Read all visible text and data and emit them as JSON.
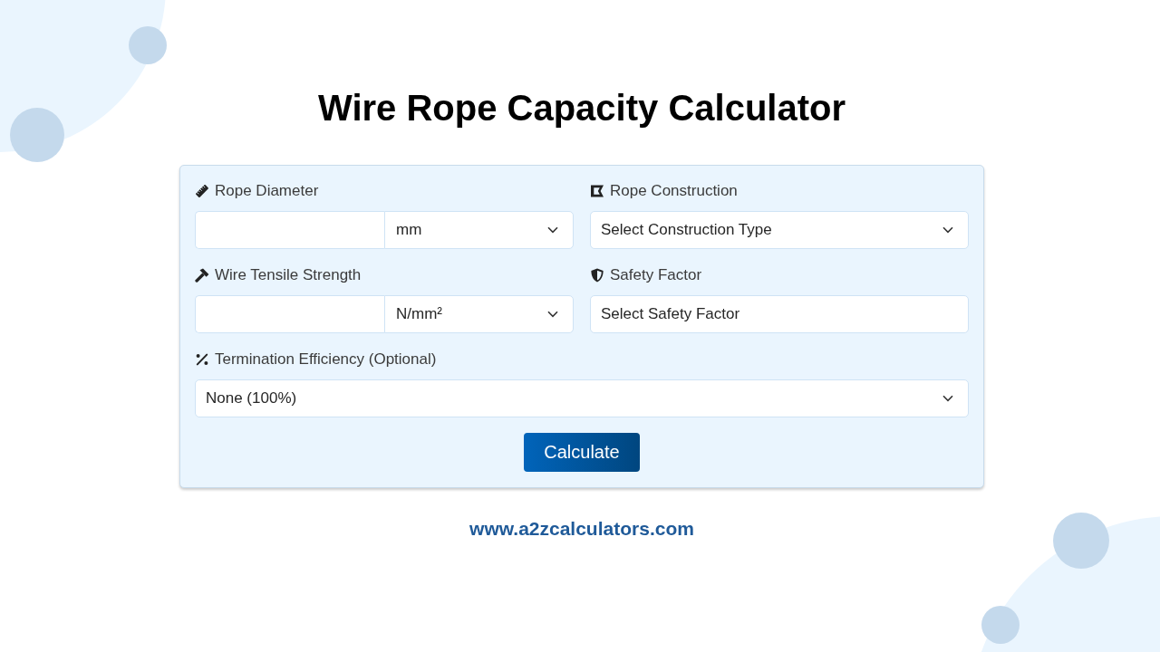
{
  "title": "Wire Rope Capacity Calculator",
  "form": {
    "rows": [
      {
        "fields": [
          {
            "kind": "value_with_unit",
            "label": "Rope Diameter",
            "unit": "mm"
          },
          {
            "kind": "select",
            "label": "Rope Construction",
            "value": "Select Construction Type"
          }
        ]
      },
      {
        "fields": [
          {
            "kind": "value_with_unit",
            "label": "Wire Tensile Strength",
            "unit": "N/mm²"
          },
          {
            "kind": "text",
            "label": "Safety Factor",
            "value": "Select Safety Factor"
          }
        ]
      },
      {
        "fields": [
          {
            "kind": "select",
            "label": "Termination Efficiency (Optional)",
            "value": "None (100%)"
          }
        ]
      }
    ],
    "submit_button": "Calculate"
  },
  "footer_url": "www.a2zcalculators.com"
}
